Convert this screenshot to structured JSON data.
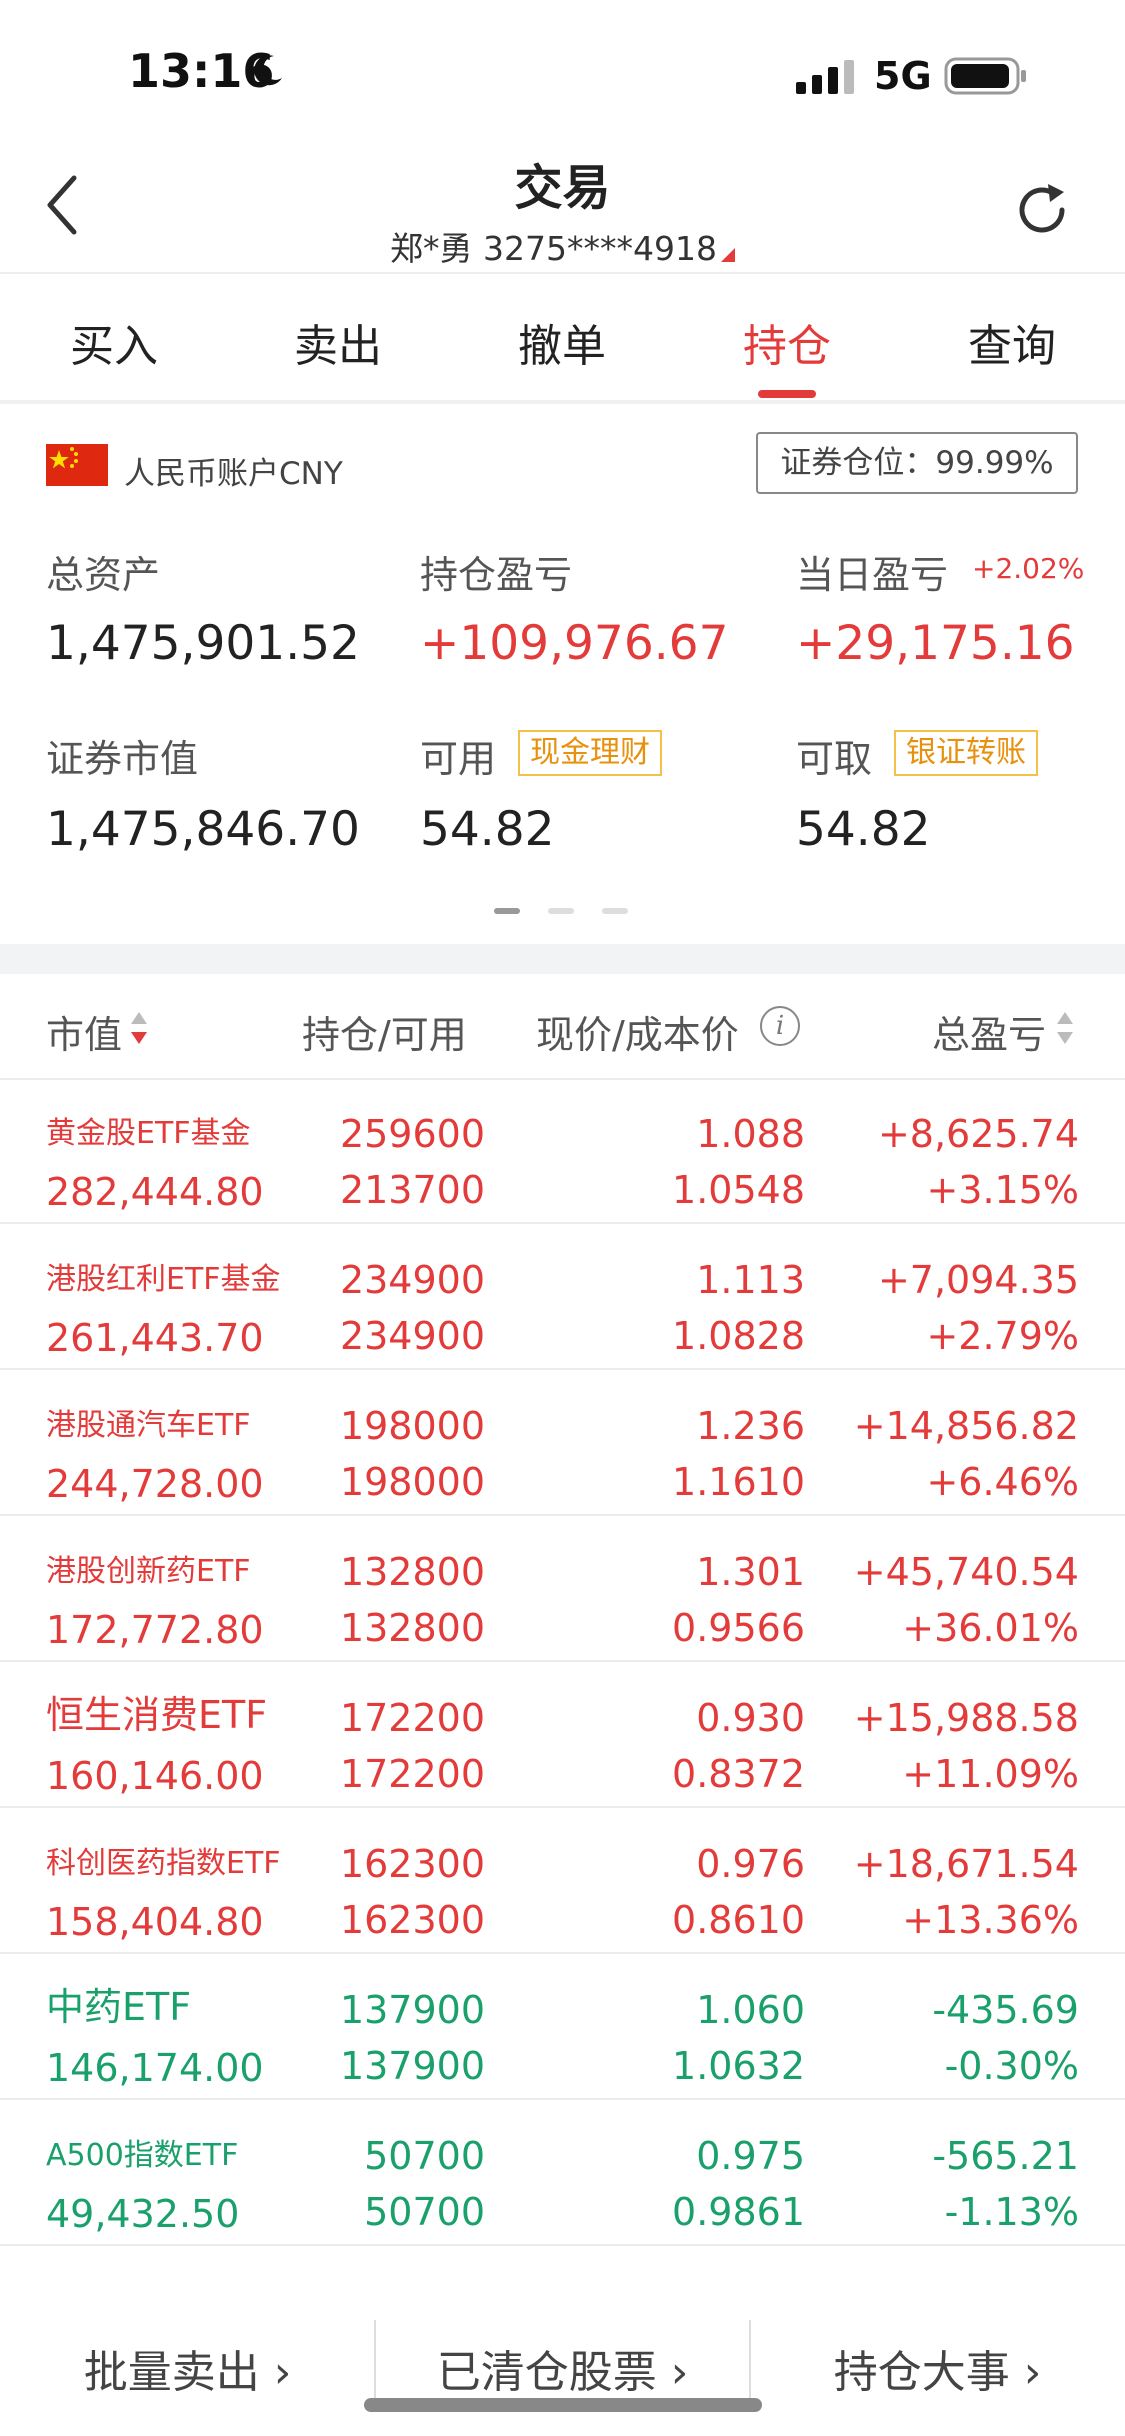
{
  "status_bar": {
    "time": "13:16",
    "network": "5G"
  },
  "header": {
    "title": "交易",
    "account": "郑*勇 3275****4918"
  },
  "tabs": [
    {
      "label": "买入"
    },
    {
      "label": "卖出"
    },
    {
      "label": "撤单"
    },
    {
      "label": "持仓",
      "active": true
    },
    {
      "label": "查询"
    }
  ],
  "account_panel": {
    "currency_label": "人民币账户CNY",
    "position_ratio": "证券仓位：99.99%",
    "total_assets_label": "总资产",
    "total_assets": "1,475,901.52",
    "holding_pnl_label": "持仓盈亏",
    "holding_pnl": "+109,976.67",
    "daily_pnl_label": "当日盈亏",
    "daily_pnl_pct": "+2.02%",
    "daily_pnl": "+29,175.16",
    "market_value_label": "证券市值",
    "market_value": "1,475,846.70",
    "available_label": "可用",
    "available_tag": "现金理财",
    "available": "54.82",
    "withdrawable_label": "可取",
    "withdrawable_tag": "银证转账",
    "withdrawable": "54.82"
  },
  "table_header": {
    "market_value": "市值",
    "position": "持仓/可用",
    "price": "现价/成本价",
    "pnl": "总盈亏"
  },
  "holdings": [
    {
      "name": "黄金股ETF基金",
      "market_value": "282,444.80",
      "position": "259600",
      "available": "213700",
      "price": "1.088",
      "cost": "1.0548",
      "pnl": "+8,625.74",
      "pnl_pct": "+3.15%",
      "trend": "up"
    },
    {
      "name": "港股红利ETF基金",
      "market_value": "261,443.70",
      "position": "234900",
      "available": "234900",
      "price": "1.113",
      "cost": "1.0828",
      "pnl": "+7,094.35",
      "pnl_pct": "+2.79%",
      "trend": "up"
    },
    {
      "name": "港股通汽车ETF",
      "market_value": "244,728.00",
      "position": "198000",
      "available": "198000",
      "price": "1.236",
      "cost": "1.1610",
      "pnl": "+14,856.82",
      "pnl_pct": "+6.46%",
      "trend": "up"
    },
    {
      "name": "港股创新药ETF",
      "market_value": "172,772.80",
      "position": "132800",
      "available": "132800",
      "price": "1.301",
      "cost": "0.9566",
      "pnl": "+45,740.54",
      "pnl_pct": "+36.01%",
      "trend": "up"
    },
    {
      "name": "恒生消费ETF",
      "market_value": "160,146.00",
      "position": "172200",
      "available": "172200",
      "price": "0.930",
      "cost": "0.8372",
      "pnl": "+15,988.58",
      "pnl_pct": "+11.09%",
      "trend": "up",
      "big": true
    },
    {
      "name": "科创医药指数ETF",
      "market_value": "158,404.80",
      "position": "162300",
      "available": "162300",
      "price": "0.976",
      "cost": "0.8610",
      "pnl": "+18,671.54",
      "pnl_pct": "+13.36%",
      "trend": "up"
    },
    {
      "name": "中药ETF",
      "market_value": "146,174.00",
      "position": "137900",
      "available": "137900",
      "price": "1.060",
      "cost": "1.0632",
      "pnl": "-435.69",
      "pnl_pct": "-0.30%",
      "trend": "down",
      "big": true
    },
    {
      "name": "A500指数ETF",
      "market_value": "49,432.50",
      "position": "50700",
      "available": "50700",
      "price": "0.975",
      "cost": "0.9861",
      "pnl": "-565.21",
      "pnl_pct": "-1.13%",
      "trend": "down"
    }
  ],
  "bottom_bar": {
    "batch_sell": "批量卖出",
    "cleared_stocks": "已清仓股票",
    "position_events": "持仓大事"
  },
  "colors": {
    "up": "#e33a3a",
    "down": "#1aa06b",
    "accent": "#e33a3a",
    "tag": "#e8910e"
  }
}
